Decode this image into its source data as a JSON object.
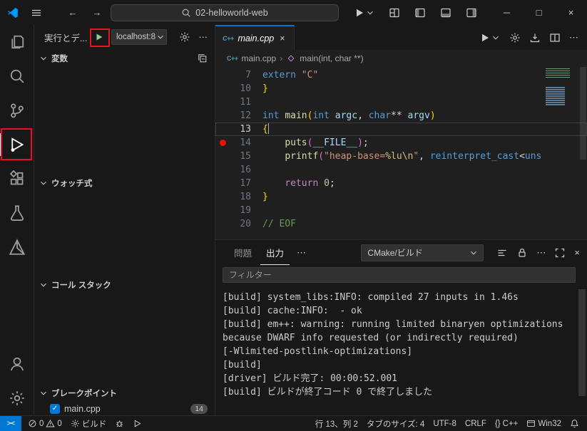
{
  "colors": {
    "accent_blue": "#0078d4",
    "annotation_red": "#e81123",
    "breakpoint_red": "#e51400",
    "run_green": "#89d185",
    "editor_bg": "#1f1f1f",
    "chrome_bg": "#181818"
  },
  "icons": {
    "back": "←",
    "forward": "→",
    "ellipsis": "⋯",
    "close": "×",
    "minimize": "─",
    "maximize": "□",
    "breadcrumb_sep": "›",
    "check": "✓",
    "braces": "{}",
    "remote": "><",
    "cpp_file": "C++"
  },
  "title_bar": {
    "search_value": "02-helloworld-web"
  },
  "sidebar": {
    "title": "実行とデ...",
    "target_dropdown": "localhost:8",
    "sections": [
      {
        "label": "変数"
      },
      {
        "label": "ウォッチ式"
      },
      {
        "label": "コール スタック"
      },
      {
        "label": "ブレークポイント"
      }
    ],
    "breakpoint_item": {
      "label": "main.cpp",
      "badge": "14"
    }
  },
  "editor": {
    "tab_label": "main.cpp",
    "breadcrumb": {
      "file": "main.cpp",
      "symbol": "main(int, char **)"
    },
    "lines": [
      {
        "num": "7",
        "tokens": [
          [
            "extern",
            "kw"
          ],
          [
            " ",
            ""
          ],
          [
            "\"C\"",
            "str"
          ]
        ]
      },
      {
        "num": "10",
        "tokens": [
          [
            "}",
            "br"
          ]
        ]
      },
      {
        "num": "11",
        "tokens": []
      },
      {
        "num": "12",
        "tokens": [
          [
            "int",
            "kw"
          ],
          [
            " ",
            ""
          ],
          [
            "main",
            "fn"
          ],
          [
            "(",
            "br"
          ],
          [
            "int",
            "kw"
          ],
          [
            " ",
            ""
          ],
          [
            "argc",
            "var"
          ],
          [
            ", ",
            ""
          ],
          [
            "char",
            "kw"
          ],
          [
            "**",
            ""
          ],
          [
            " ",
            ""
          ],
          [
            "argv",
            "var"
          ],
          [
            ")",
            "br"
          ]
        ]
      },
      {
        "num": "13",
        "tokens": [
          [
            "{",
            "br"
          ]
        ],
        "current": true,
        "cursor": true
      },
      {
        "num": "14",
        "tokens": [
          [
            "    ",
            ""
          ],
          [
            "puts",
            "fn"
          ],
          [
            "(",
            "br2"
          ],
          [
            "__FILE__",
            "var"
          ],
          [
            ")",
            "br2"
          ],
          [
            ";",
            ""
          ]
        ],
        "breakpoint": true
      },
      {
        "num": "15",
        "tokens": [
          [
            "    ",
            ""
          ],
          [
            "printf",
            "fn"
          ],
          [
            "(",
            "br2"
          ],
          [
            "\"heap-base=",
            "str"
          ],
          [
            "%lu",
            "esc"
          ],
          [
            "\\n",
            "esc"
          ],
          [
            "\"",
            "str"
          ],
          [
            ", ",
            ""
          ],
          [
            "reinterpret_cast",
            "kw"
          ],
          [
            "<",
            ""
          ],
          [
            "uns",
            "kw"
          ]
        ]
      },
      {
        "num": "16",
        "tokens": []
      },
      {
        "num": "17",
        "tokens": [
          [
            "    ",
            ""
          ],
          [
            "return",
            "ctrl"
          ],
          [
            " ",
            ""
          ],
          [
            "0",
            "num"
          ],
          [
            ";",
            ""
          ]
        ]
      },
      {
        "num": "18",
        "tokens": [
          [
            "}",
            "br"
          ]
        ]
      },
      {
        "num": "19",
        "tokens": []
      },
      {
        "num": "20",
        "tokens": [
          [
            "// EOF",
            "cmt"
          ]
        ]
      }
    ]
  },
  "panel": {
    "tabs": [
      {
        "label": "問題"
      },
      {
        "label": "出力"
      }
    ],
    "channel_dropdown": "CMake/ビルド",
    "filter_placeholder": "フィルター",
    "output_lines": [
      "[build] system_libs:INFO: compiled 27 inputs in 1.46s",
      "[build] cache:INFO:  - ok",
      "[build] em++: warning: running limited binaryen optimizations",
      "because DWARF info requested (or indirectly required)",
      "[-Wlimited-postlink-optimizations]",
      "[build]",
      "[driver] ビルド完了: 00:00:52.001",
      "[build] ビルドが終了コード 0 で終了しました"
    ]
  },
  "status_bar": {
    "errors": "0",
    "warnings": "0",
    "build_label": "ビルド",
    "line_col": "行 13、列 2",
    "tab_size": "タブのサイズ: 4",
    "encoding": "UTF-8",
    "eol": "CRLF",
    "language": "C++",
    "platform": "Win32"
  }
}
